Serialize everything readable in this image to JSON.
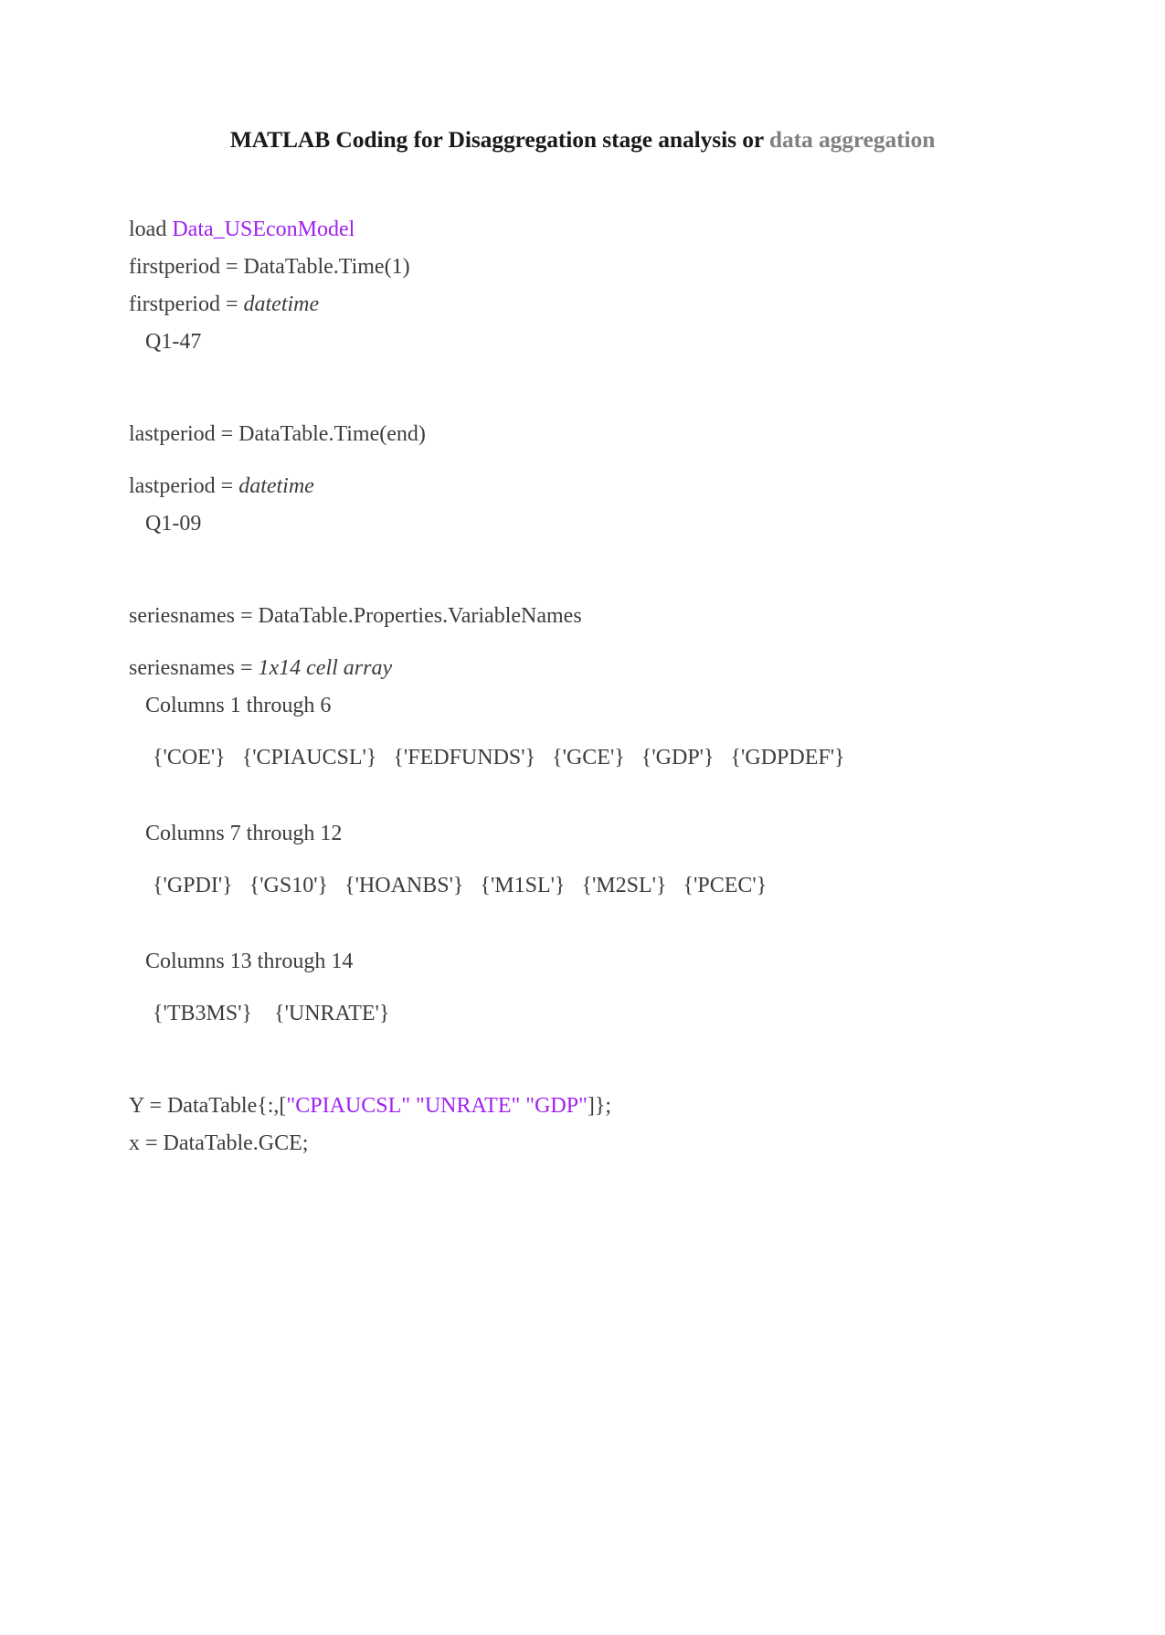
{
  "title": {
    "main": "MATLAB Coding for Disaggregation stage analysis or ",
    "accent": "data aggregation"
  },
  "colors": {
    "string_purple": "#a020f0",
    "title_accent_gray": "#808080",
    "body_text": "#3c3c3c",
    "page_background": "#ffffff"
  },
  "code": {
    "load_keyword": "load ",
    "load_target": "Data_USEconModel",
    "firstperiod_call": "firstperiod = DataTable.Time(1)",
    "firstperiod_result_label": "firstperiod = ",
    "firstperiod_result_type": "datetime",
    "firstperiod_value": "Q1-47",
    "lastperiod_call": "lastperiod = DataTable.Time(end)",
    "lastperiod_result_label": "lastperiod = ",
    "lastperiod_result_type": "datetime",
    "lastperiod_value": "Q1-09",
    "seriesnames_call": "seriesnames = DataTable.Properties.VariableNames",
    "seriesnames_result_label": "seriesnames = ",
    "seriesnames_result_type": "1x14 cell array",
    "columns_groups": [
      {
        "header": "Columns 1 through 6",
        "cells": "{'COE'}   {'CPIAUCSL'}   {'FEDFUNDS'}   {'GCE'}   {'GDP'}   {'GDPDEF'}"
      },
      {
        "header": "Columns 7 through 12",
        "cells": "{'GPDI'}   {'GS10'}   {'HOANBS'}   {'M1SL'}   {'M2SL'}   {'PCEC'}"
      },
      {
        "header": "Columns 13 through 14",
        "cells": "{'TB3MS'}    {'UNRATE'}"
      }
    ],
    "y_assign_prefix": "Y = DataTable{:,[",
    "y_assign_strings": "\"CPIAUCSL\" \"UNRATE\" \"GDP\"",
    "y_assign_suffix": "]};",
    "x_assign": "x = DataTable.GCE;"
  }
}
